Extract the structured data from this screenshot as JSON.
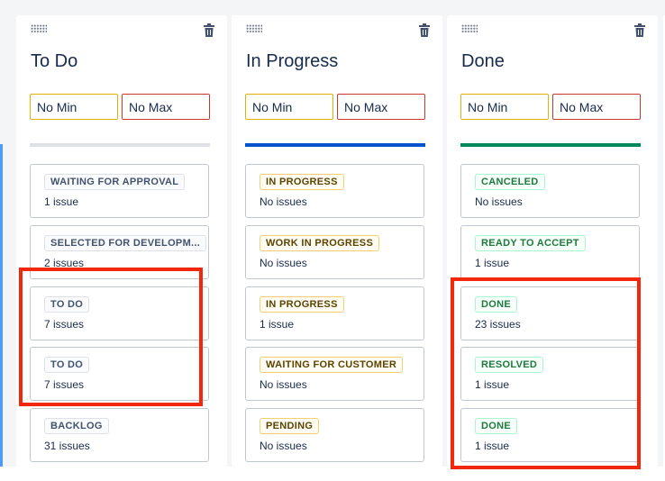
{
  "columns": [
    {
      "title": "To Do",
      "min_label": "No Min",
      "max_label": "No Max",
      "status_color": "#dfe1e6",
      "cards": [
        {
          "status": "WAITING FOR APPROVAL",
          "count": "1 issue",
          "tone": "grey"
        },
        {
          "status": "SELECTED FOR DEVELOPM...",
          "count": "2 issues",
          "tone": "grey"
        },
        {
          "status": "TO DO",
          "count": "7 issues",
          "tone": "grey"
        },
        {
          "status": "TO DO",
          "count": "7 issues",
          "tone": "grey"
        },
        {
          "status": "BACKLOG",
          "count": "31 issues",
          "tone": "grey"
        }
      ]
    },
    {
      "title": "In Progress",
      "min_label": "No Min",
      "max_label": "No Max",
      "status_color": "#0052cc",
      "cards": [
        {
          "status": "IN PROGRESS",
          "count": "No issues",
          "tone": "yellow"
        },
        {
          "status": "WORK IN PROGRESS",
          "count": "No issues",
          "tone": "yellow"
        },
        {
          "status": "IN PROGRESS",
          "count": "1 issue",
          "tone": "yellow"
        },
        {
          "status": "WAITING FOR CUSTOMER",
          "count": "No issues",
          "tone": "yellow"
        },
        {
          "status": "PENDING",
          "count": "No issues",
          "tone": "yellow"
        }
      ]
    },
    {
      "title": "Done",
      "min_label": "No Min",
      "max_label": "No Max",
      "status_color": "#00875a",
      "cards": [
        {
          "status": "CANCELED",
          "count": "No issues",
          "tone": "green"
        },
        {
          "status": "READY TO ACCEPT",
          "count": "1 issue",
          "tone": "green"
        },
        {
          "status": "DONE",
          "count": "23 issues",
          "tone": "green"
        },
        {
          "status": "RESOLVED",
          "count": "1 issue",
          "tone": "green"
        },
        {
          "status": "DONE",
          "count": "1 issue",
          "tone": "green"
        }
      ]
    }
  ],
  "icons": {
    "drag": "drag-handle-icon",
    "delete": "trash-icon"
  },
  "colors": {
    "highlight": "#f2270c"
  }
}
